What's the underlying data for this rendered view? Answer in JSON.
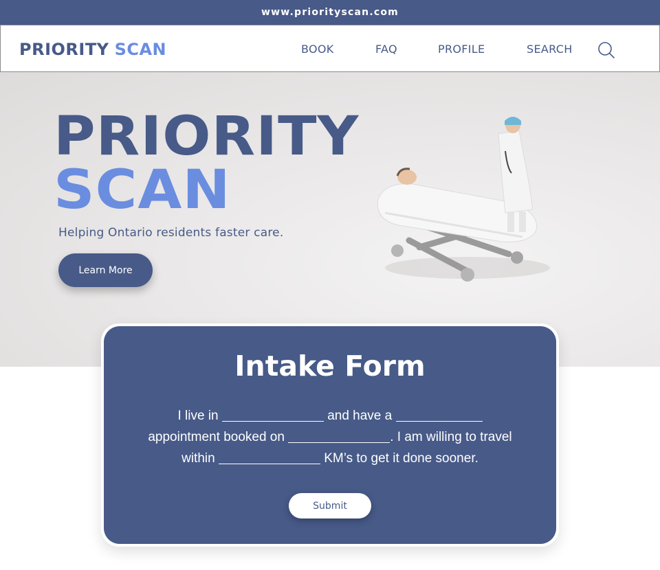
{
  "browser": {
    "url": "www.priorityscan.com"
  },
  "header": {
    "brand_part1": "PRIORITY",
    "brand_part2": "SCAN",
    "nav": [
      "BOOK",
      "FAQ",
      "PROFILE",
      "SEARCH"
    ]
  },
  "hero": {
    "title_line1": "PRIORITY",
    "title_line2": "SCAN",
    "tagline": "Helping Ontario residents faster care.",
    "cta_label": "Learn More"
  },
  "form": {
    "title": "Intake Form",
    "segments": [
      "I live in",
      "and have a",
      "appointment booked on",
      ". I am willing to travel within",
      "KM’s to get it done sooner."
    ],
    "submit_label": "Submit"
  },
  "colors": {
    "brand_dark": "#475a88",
    "brand_light": "#6a8de0",
    "background": "#ffffff"
  }
}
